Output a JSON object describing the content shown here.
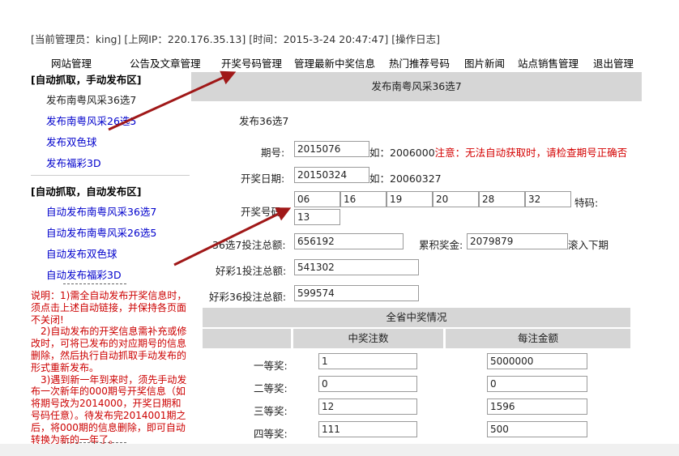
{
  "status": {
    "admin_label": "[当前管理员：",
    "admin_name": "king",
    "ip_label": "] [上网IP：",
    "ip": "220.176.35.13",
    "time_label": "] [时间：",
    "time": "2015-3-24 20:47:47",
    "log_link": "] [操作日志]"
  },
  "nav": [
    "网站管理",
    "公告及文章管理",
    "开奖号码管理",
    "管理最新中奖信息",
    "热门推荐号码",
    "图片新闻",
    "站点销售管理",
    "退出管理"
  ],
  "sidebar": {
    "manual_title": "[自动抓取，手动发布区]",
    "manual_items": [
      "发布南粤风采36选7",
      "发布南粤风采26选5",
      "发布双色球",
      "发布福彩3D"
    ],
    "auto_title": "[自动抓取，自动发布区]",
    "auto_items": [
      "自动发布南粤风采36选7",
      "自动发布南粤风采26选5",
      "自动发布双色球",
      "自动发布福彩3D"
    ],
    "note_1": "说明：1)需全自动发布开奖信息时，须点击上述自动链接，并保持各页面不关闭!",
    "note_2": "2)自动发布的开奖信息需补充或修改时，可将已发布的对应期号的信息删除，然后执行自动抓取手动发布的形式重新发布。",
    "note_3": "3)遇到新一年到来时，须先手动发布一次新年的000期号开奖信息（如将期号改为2014000，开奖日期和号码任意）。待发布完2014001期之后，将000期的信息删除，即可自动转换为新的一年了。"
  },
  "main": {
    "header": "发布南粤风采36选7",
    "subtitle": "发布36选7",
    "period_label": "期号:",
    "period_value": "2015076",
    "period_example": "如：2006000",
    "period_warning": "注意：无法自动获取时，请检查期号正确否",
    "date_label": "开奖日期:",
    "date_value": "20150324",
    "date_example": "如：20060327",
    "numbers_label": "开奖号码:",
    "numbers": [
      "06",
      "16",
      "19",
      "20",
      "28",
      "32"
    ],
    "special_label": "特码:",
    "special_value": "13",
    "bet36_label": "36选7投注总额:",
    "bet36_value": "656192",
    "jackpot_label": "累积奖金:",
    "jackpot_value": "2079879",
    "jackpot_suffix": "滚入下期",
    "hc1_label": "好彩1投注总额:",
    "hc1_value": "541302",
    "hc36_label": "好彩36投注总额:",
    "hc36_value": "599574",
    "prize_title": "全省中奖情况",
    "prize_col_count": "中奖注数",
    "prize_col_amount": "每注金额",
    "prizes": [
      {
        "name": "一等奖:",
        "count": "1",
        "amount": "5000000"
      },
      {
        "name": "二等奖:",
        "count": "0",
        "amount": "0"
      },
      {
        "name": "三等奖:",
        "count": "12",
        "amount": "1596"
      },
      {
        "name": "四等奖:",
        "count": "111",
        "amount": "500"
      }
    ]
  },
  "colors": {
    "link_blue": "#0000cc",
    "note_red": "#cc0000",
    "warn_red": "#d40000",
    "arrow": "#a01818",
    "band_gray": "#d6d6d6"
  }
}
